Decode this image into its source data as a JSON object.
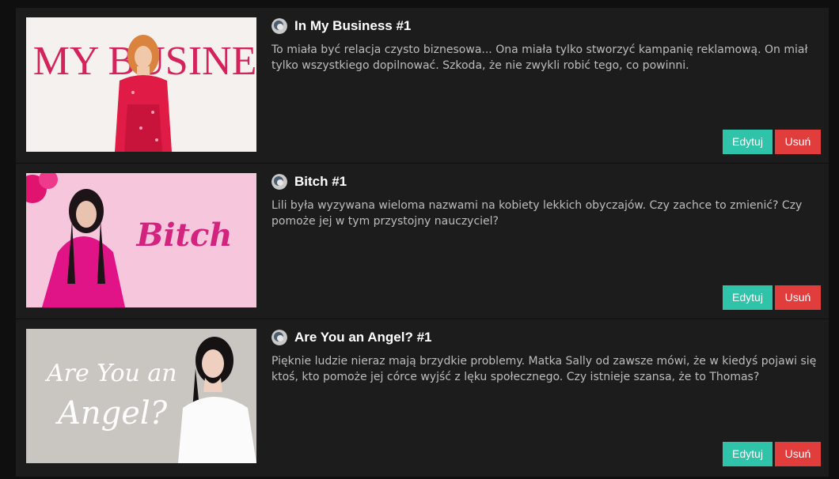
{
  "stories": [
    {
      "title": "In My Business #1",
      "description": "To miała być relacja czysto biznesowa... Ona miała tylko stworzyć kampanię reklamową. On miał tylko wszystkiego dopilnować. Szkoda, że nie zwykli robić tego, co powinni.",
      "cover_text": "IN MY BUSINESS",
      "edit_label": "Edytuj",
      "delete_label": "Usuń"
    },
    {
      "title": "Bitch #1",
      "description": "Lili była wyzywana wieloma nazwami na kobiety lekkich obyczajów. Czy zachce to zmienić? Czy pomoże jej w tym przystojny nauczyciel?",
      "cover_text": "Bitch",
      "edit_label": "Edytuj",
      "delete_label": "Usuń"
    },
    {
      "title": "Are You an Angel? #1",
      "description": "Pięknie ludzie nieraz mają brzydkie problemy. Matka Sally od zawsze mówi, że w kiedyś pojawi się ktoś, kto pomoże jej córce wyjść z lęku społecznego. Czy istnieje szansa, że to Thomas?",
      "cover_text_line1": "Are You an",
      "cover_text_line2": "Angel?",
      "edit_label": "Edytuj",
      "delete_label": "Usuń"
    }
  ],
  "colors": {
    "edit": "#2fc3a9",
    "delete": "#e23d3d",
    "row_bg": "#1c1c1c"
  }
}
